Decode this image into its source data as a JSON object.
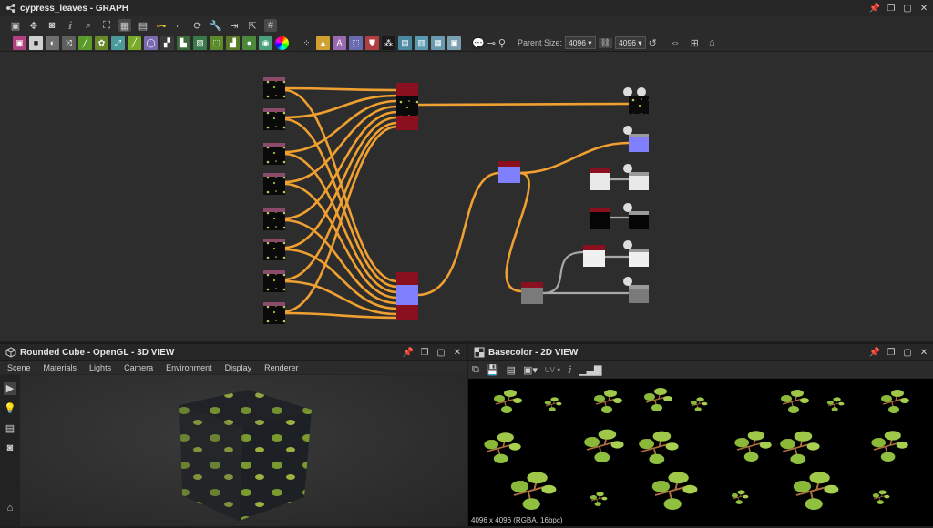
{
  "graph": {
    "title": "cypress_leaves - GRAPH",
    "parent_size_label": "Parent Size:",
    "parent_size_w": "4096",
    "parent_size_h": "4096"
  },
  "view3d": {
    "title": "Rounded Cube - OpenGL - 3D VIEW",
    "menu": [
      "Scene",
      "Materials",
      "Lights",
      "Camera",
      "Environment",
      "Display",
      "Renderer"
    ]
  },
  "view2d": {
    "title": "Basecolor - 2D VIEW",
    "uv_label": "UV",
    "status": "4096 x 4096 (RGBA, 16bpc)"
  },
  "icons": {
    "graph_title": "graph-icon",
    "view3d_title": "cube-icon",
    "view2d_title": "checker-icon"
  },
  "colors": {
    "connection": "#f0a030",
    "grey_connection": "#a8a8a8",
    "node_header_red": "#8a1020",
    "node_blue": "#8080ff"
  }
}
